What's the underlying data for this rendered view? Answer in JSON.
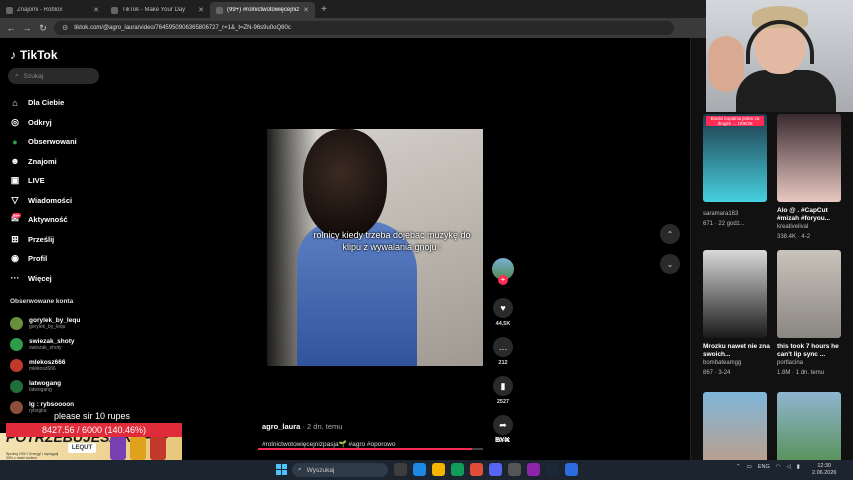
{
  "browser": {
    "tabs": [
      {
        "title": "Znajomi - Roblox",
        "active": false,
        "fav_color": "#444"
      },
      {
        "title": "TikTok - Make Your Day",
        "active": false,
        "fav_color": "#111"
      },
      {
        "title": "(99+) #rolnictwotowięcejniżpasj...",
        "active": true,
        "fav_color": "#111"
      }
    ],
    "new_tab": "+",
    "url": "tiktok.com/@agro_laura/video/7645950906365806727_r=1&_t=ZN-96s9u0oQ80c"
  },
  "sidebar": {
    "logo": "TikTok",
    "search_placeholder": "Szukaj",
    "menu": [
      {
        "label": "Dla Ciebie",
        "icon": "home-icon",
        "glyph": "⌂"
      },
      {
        "label": "Odkryj",
        "icon": "compass-icon",
        "glyph": "◎"
      },
      {
        "label": "Obserwowani",
        "icon": "following-avatar-icon",
        "glyph": "●"
      },
      {
        "label": "Znajomi",
        "icon": "friends-icon",
        "glyph": "☻"
      },
      {
        "label": "LIVE",
        "icon": "live-icon",
        "glyph": "▣"
      },
      {
        "label": "Wiadomości",
        "icon": "messages-icon",
        "glyph": "▽"
      },
      {
        "label": "Aktywność",
        "icon": "activity-icon",
        "glyph": "✉",
        "badge": "99+"
      },
      {
        "label": "Prześlij",
        "icon": "upload-icon",
        "glyph": "⊞"
      },
      {
        "label": "Profil",
        "icon": "profile-icon",
        "glyph": "◉"
      },
      {
        "label": "Więcej",
        "icon": "more-icon",
        "glyph": "···"
      }
    ],
    "following_title": "Obserwowane konta",
    "accounts": [
      {
        "name": "gorylek_by_lequ",
        "handle": "gorylek_by_lequ",
        "color": "#6a8f3c"
      },
      {
        "name": "swiezak_shoty",
        "handle": "swiezak_shoty",
        "color": "#2e9d4a"
      },
      {
        "name": "mlekosz666",
        "handle": "mlekosz666",
        "color": "#c0392b"
      },
      {
        "name": "latwogang",
        "handle": "latwogang",
        "color": "#1f6f3a"
      },
      {
        "name": "lg : rybsoooon",
        "handle": "rybsgka",
        "color": "#8c4f3a"
      }
    ]
  },
  "video": {
    "caption_overlay": "rolnicy kiedy trzeba dojebac muzykę do klipu z wywalania gnoju :",
    "author": "agro_laura",
    "posted": " · 2 dn. temu",
    "tags": "#rolnictwotowięcejnizpasja🌱 #agro #oporowo",
    "progress": 0.95,
    "actions": [
      {
        "name": "like",
        "icon": "heart-icon",
        "glyph": "♥",
        "count": "44.5K"
      },
      {
        "name": "comment",
        "icon": "comment-icon",
        "glyph": "…",
        "count": "212"
      },
      {
        "name": "save",
        "icon": "bookmark-icon",
        "glyph": "▮",
        "count": "2527"
      },
      {
        "name": "share",
        "icon": "share-icon",
        "glyph": "➦",
        "count": "19.4K"
      }
    ],
    "embed_label": "BYX"
  },
  "nav": {
    "up": "⌃",
    "down": "⌄"
  },
  "recommendations": [
    {
      "title": "",
      "user": "saramara163",
      "views": "671",
      "age": "22 godz...",
      "sticker": "Biedni kopalnia jeden za drugim ... 1/06/26",
      "color1": "#1e3a4a",
      "color2": "#46d0e0"
    },
    {
      "title": "Alo @ . #CapCut #mizah #foryou...",
      "user": "kreativelival",
      "views": "338.4K",
      "age": "4-2",
      "color1": "#3a2a30",
      "color2": "#e9c9c2"
    },
    {
      "title": "Mrozku nawet nie zna swoich...",
      "user": "bombateamgg",
      "views": "867",
      "age": "3-24",
      "color1": "#d9d9d9",
      "color2": "#1a1a1a"
    },
    {
      "title": "this took 7 hours he can't lip sync ...",
      "user": "portlacina",
      "views": "1.8M",
      "age": "1 dn. temu",
      "color1": "#c8c4bc",
      "color2": "#8a8680"
    },
    {
      "title": "",
      "user": "",
      "views": "",
      "age": "",
      "color1": "#7fb6d8",
      "color2": "#c99a7c"
    },
    {
      "title": "",
      "user": "",
      "views": "",
      "age": "",
      "color1": "#8fb4d0",
      "color2": "#4b8a3c"
    }
  ],
  "stream": {
    "message": "please sir 10 rupes",
    "goal": "8427.56 / 6000 (140.46%)",
    "ad_headline": "POTRZEBUJESZ KOPA?",
    "ad_small": "Sprobuj HOLY Energy! i wyciągnij 30% z moim kodem",
    "ad_code": "LEQUT"
  },
  "taskbar": {
    "search_placeholder": "Wyszukaj",
    "language": "ENG",
    "time": "12:30",
    "date": "2.06.2026",
    "app_colors": [
      "#3d3d3d",
      "#1e88e5",
      "#f4b400",
      "#0f9d58",
      "#e04e3a",
      "#5865f2",
      "#555",
      "#8e24aa",
      "#1b2838",
      "#2d6cdf"
    ]
  }
}
